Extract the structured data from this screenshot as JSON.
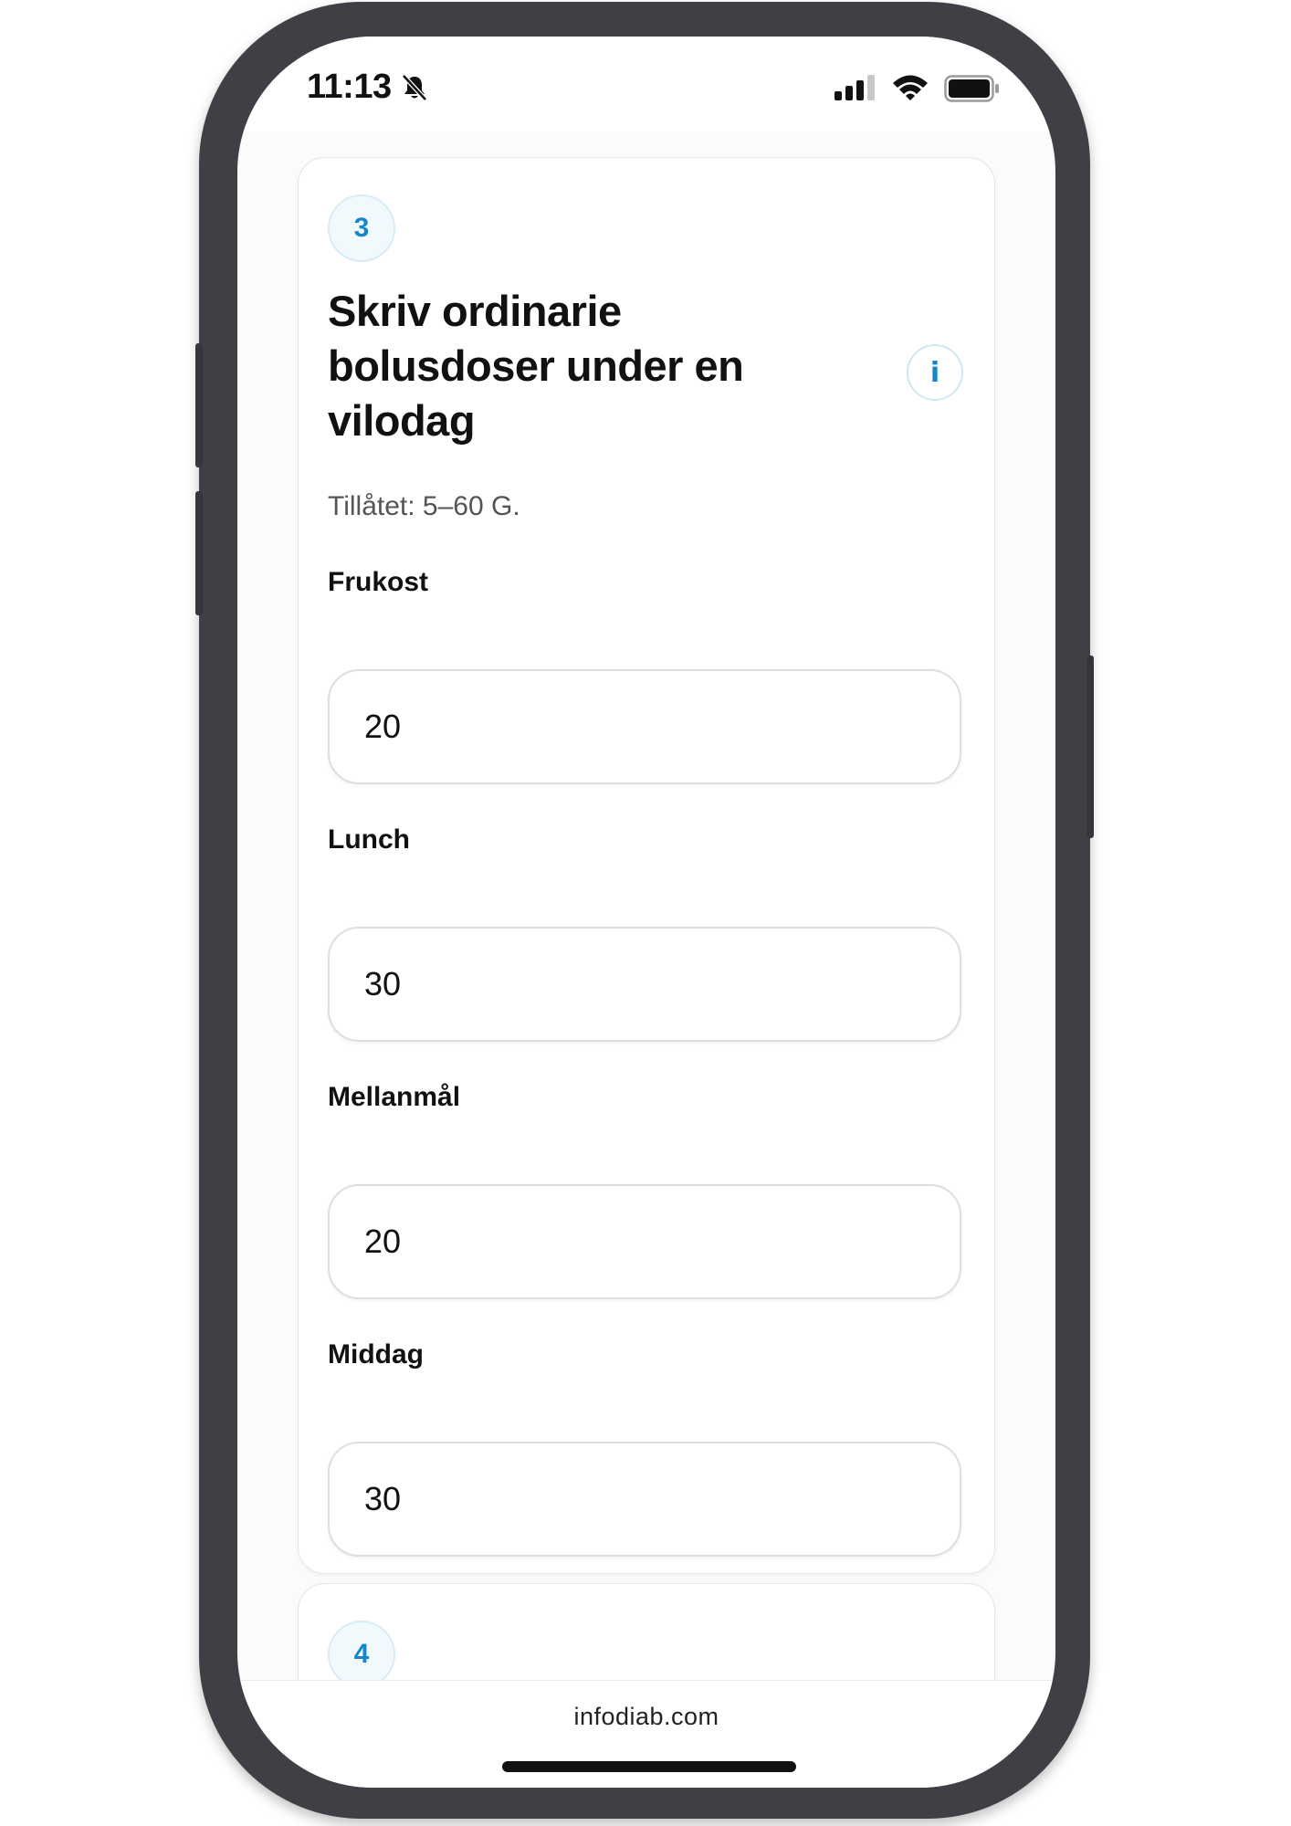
{
  "status_bar": {
    "time": "11:13",
    "icons": [
      "bell-slash-icon",
      "cellular-signal-icon",
      "wifi-icon",
      "battery-icon"
    ]
  },
  "step3": {
    "number": "3",
    "title": "Skriv ordinarie bolusdoser under en vilodag",
    "info_icon": "i",
    "allowed_text": "Tillåtet: 5–60 G.",
    "fields": [
      {
        "label": "Frukost",
        "value": "20"
      },
      {
        "label": "Lunch",
        "value": "30"
      },
      {
        "label": "Mellanmål",
        "value": "20"
      },
      {
        "label": "Middag",
        "value": "30"
      }
    ]
  },
  "step4": {
    "number": "4"
  },
  "browser": {
    "url": "infodiab.com"
  },
  "colors": {
    "accent": "#1487c8",
    "frame": "#3f4046"
  }
}
